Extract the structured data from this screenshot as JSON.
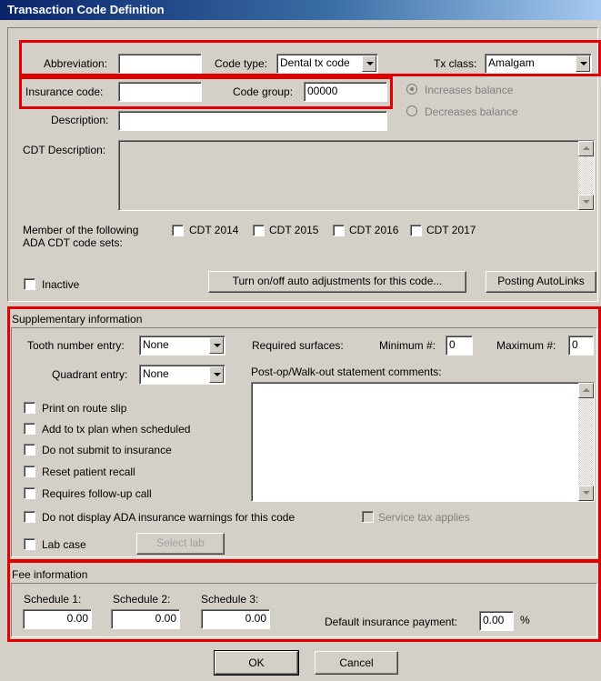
{
  "window": {
    "title": "Transaction Code Definition"
  },
  "top": {
    "abbreviation_label": "Abbreviation:",
    "abbreviation_value": "",
    "code_type_label": "Code type:",
    "code_type_value": "Dental tx code",
    "tx_class_label": "Tx class:",
    "tx_class_value": "Amalgam",
    "insurance_code_label": "Insurance code:",
    "insurance_code_value": "",
    "code_group_label": "Code group:",
    "code_group_value": "00000",
    "increases_balance": "Increases balance",
    "decreases_balance": "Decreases balance",
    "description_label": "Description:",
    "description_value": "",
    "cdt_description_label": "CDT Description:",
    "member_label_1": "Member of the following",
    "member_label_2": "ADA CDT code sets:",
    "cdt_sets": [
      "CDT 2014",
      "CDT 2015",
      "CDT 2016",
      "CDT 2017"
    ],
    "inactive_label": "Inactive",
    "auto_adjust_button": "Turn on/off auto adjustments for this code...",
    "posting_autolinks_button": "Posting AutoLinks"
  },
  "supplementary": {
    "section_title": "Supplementary information",
    "tooth_number_label": "Tooth number entry:",
    "tooth_number_value": "None",
    "quadrant_label": "Quadrant entry:",
    "quadrant_value": "None",
    "required_surfaces_label": "Required surfaces:",
    "minimum_label": "Minimum #:",
    "minimum_value": "0",
    "maximum_label": "Maximum #:",
    "maximum_value": "0",
    "comments_label": "Post-op/Walk-out statement comments:",
    "checkboxes": [
      "Print on route slip",
      "Add to tx plan when scheduled",
      "Do not submit to insurance",
      "Reset patient recall",
      "Requires follow-up call",
      "Do not display ADA insurance warnings for this code"
    ],
    "service_tax_label": "Service tax applies",
    "lab_case_label": "Lab case",
    "select_lab_button": "Select lab"
  },
  "fee": {
    "section_title": "Fee information",
    "schedule1_label": "Schedule 1:",
    "schedule1_value": "0.00",
    "schedule2_label": "Schedule 2:",
    "schedule2_value": "0.00",
    "schedule3_label": "Schedule 3:",
    "schedule3_value": "0.00",
    "default_payment_label": "Default insurance payment:",
    "default_payment_value": "0.00",
    "percent_sign": "%"
  },
  "buttons": {
    "ok": "OK",
    "cancel": "Cancel"
  },
  "colors": {
    "highlight": "#e00000",
    "dialog_bg": "#d4d0c8",
    "title_bar": "#0a246a"
  }
}
